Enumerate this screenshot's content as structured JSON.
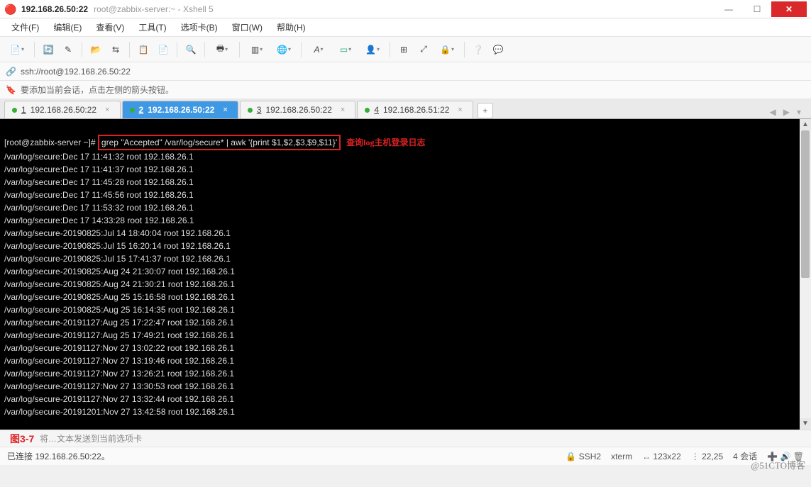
{
  "window": {
    "title": "192.168.26.50:22",
    "subtitle": "root@zabbix-server:~ - Xshell 5"
  },
  "win_btns": {
    "min": "—",
    "max": "☐",
    "close": "✕"
  },
  "menu": {
    "file": "文件(F)",
    "edit": "编辑(E)",
    "view": "查看(V)",
    "tools": "工具(T)",
    "tabs": "选项卡(B)",
    "window": "窗口(W)",
    "help": "帮助(H)"
  },
  "address": {
    "url": "ssh://root@192.168.26.50:22"
  },
  "hint": {
    "text": "要添加当前会话，点击左侧的箭头按钮。"
  },
  "tabs": [
    {
      "num": "1",
      "label": "192.168.26.50:22",
      "active": false
    },
    {
      "num": "2",
      "label": "192.168.26.50:22",
      "active": true
    },
    {
      "num": "3",
      "label": "192.168.26.50:22",
      "active": false
    },
    {
      "num": "4",
      "label": "192.168.26.51:22",
      "active": false
    }
  ],
  "add_tab": "+",
  "terminal": {
    "prompt": "[root@zabbix-server ~]# ",
    "command": "grep \"Accepted\" /var/log/secure* | awk '{print $1,$2,$3,$9,$11}'",
    "annotation": "查询log主机登录日志",
    "lines": [
      "/var/log/secure:Dec 17 11:41:32 root 192.168.26.1",
      "/var/log/secure:Dec 17 11:41:37 root 192.168.26.1",
      "/var/log/secure:Dec 17 11:45:28 root 192.168.26.1",
      "/var/log/secure:Dec 17 11:45:56 root 192.168.26.1",
      "/var/log/secure:Dec 17 11:53:32 root 192.168.26.1",
      "/var/log/secure:Dec 17 14:33:28 root 192.168.26.1",
      "/var/log/secure-20190825:Jul 14 18:40:04 root 192.168.26.1",
      "/var/log/secure-20190825:Jul 15 16:20:14 root 192.168.26.1",
      "/var/log/secure-20190825:Jul 15 17:41:37 root 192.168.26.1",
      "/var/log/secure-20190825:Aug 24 21:30:07 root 192.168.26.1",
      "/var/log/secure-20190825:Aug 24 21:30:21 root 192.168.26.1",
      "/var/log/secure-20190825:Aug 25 15:16:58 root 192.168.26.1",
      "/var/log/secure-20190825:Aug 25 16:14:35 root 192.168.26.1",
      "/var/log/secure-20191127:Aug 25 17:22:47 root 192.168.26.1",
      "/var/log/secure-20191127:Aug 25 17:49:21 root 192.168.26.1",
      "/var/log/secure-20191127:Nov 27 13:02:22 root 192.168.26.1",
      "/var/log/secure-20191127:Nov 27 13:19:46 root 192.168.26.1",
      "/var/log/secure-20191127:Nov 27 13:26:21 root 192.168.26.1",
      "/var/log/secure-20191127:Nov 27 13:30:53 root 192.168.26.1",
      "/var/log/secure-20191127:Nov 27 13:32:44 root 192.168.26.1",
      "/var/log/secure-20191201:Nov 27 13:42:58 root 192.168.26.1"
    ]
  },
  "bottom_hint": {
    "text": "将…文本发送到当前选项卡",
    "fig": "图3-7"
  },
  "status": {
    "left": "已连接 192.168.26.50:22。",
    "ssh": "SSH2",
    "xterm": "xterm",
    "size": "123x22",
    "pos": "22,25",
    "sessions": "4 会话"
  },
  "watermark": "@51CTO博客",
  "toolbar": {
    "new": "⧉",
    "open": "📂",
    "save": "💾",
    "props": "📋",
    "copy": "📄",
    "paste": "📋",
    "search": "🔍",
    "print": "🖶",
    "fullscreen": "⛶",
    "chat": "💬",
    "globe": "🌐",
    "font": "Aₐ",
    "color": "▭",
    "user": "👤",
    "clear": "⊞",
    "expand": "⤢",
    "lock": "🔒",
    "help": "❔",
    "comment": "💬"
  }
}
